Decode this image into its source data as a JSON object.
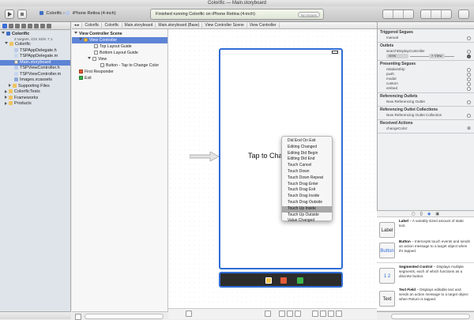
{
  "window": {
    "title_project": "Colorific",
    "title_file": "Main.storyboard"
  },
  "toolbar": {
    "scheme": "Colorific",
    "device": "iPhone Retina (4-inch)",
    "activity_text": "Finished running Colorific on iPhone Retina (4-inch)",
    "issues": "No Issues"
  },
  "navigator": {
    "items": [
      {
        "label": "Colorific",
        "sub": "2 targets, iOS SDK 7.1"
      },
      {
        "label": "Colorific"
      },
      {
        "label": "TSPAppDelegate.h"
      },
      {
        "label": "TSPAppDelegate.m"
      },
      {
        "label": "Main.storyboard"
      },
      {
        "label": "TSPViewController.h"
      },
      {
        "label": "TSPViewController.m"
      },
      {
        "label": "Images.xcassets"
      },
      {
        "label": "Supporting Files"
      },
      {
        "label": "ColorificTests"
      },
      {
        "label": "Frameworks"
      },
      {
        "label": "Products"
      }
    ]
  },
  "jumpbar": [
    "Colorific",
    "Colorific",
    "Main.storyboard",
    "Main.storyboard (Base)",
    "View Controller Scene",
    "View Controller"
  ],
  "outline": {
    "items": [
      "View Controller Scene",
      "View Controller",
      "Top Layout Guide",
      "Bottom Layout Guide",
      "View",
      "Button - Tap to Change Color",
      "First Responder",
      "Exit"
    ]
  },
  "canvas": {
    "button_label": "Tap to Change Color",
    "menu_items": [
      "Did End On Exit",
      "Editing Changed",
      "Editing Did Begin",
      "Editing Did End",
      "Touch Cancel",
      "Touch Down",
      "Touch Down Repeat",
      "Touch Drag Enter",
      "Touch Drag Exit",
      "Touch Drag Inside",
      "Touch Drag Outside",
      "Touch Up Inside",
      "Touch Up Outside",
      "Value Changed"
    ],
    "highlighted_index": 11
  },
  "inspector": {
    "triggered_segues": {
      "title": "Triggered Segues",
      "rows": [
        "manual"
      ]
    },
    "outlets": {
      "title": "Outlets",
      "rows": [
        "searchDisplayController"
      ],
      "view_row": "view",
      "view_target": "View"
    },
    "presenting_segues": {
      "title": "Presenting Segues",
      "rows": [
        "relationship",
        "push",
        "modal",
        "custom",
        "embed"
      ]
    },
    "referencing_outlets": {
      "title": "Referencing Outlets",
      "rows": [
        "New Referencing Outlet"
      ]
    },
    "referencing_collections": {
      "title": "Referencing Outlet Collections",
      "rows": [
        "New Referencing Outlet Collection"
      ]
    },
    "received_actions": {
      "title": "Received Actions",
      "rows": [
        "changeColor:"
      ]
    }
  },
  "library": {
    "tabs": [
      "{}"
    ],
    "items": [
      {
        "icon": "Label",
        "title": "Label",
        "desc": " – A variably sized amount of static text."
      },
      {
        "icon": "Button",
        "title": "Button",
        "desc": " – Intercepts touch events and sends an action message to a target object when it's tapped."
      },
      {
        "icon": "1 2",
        "title": "Segmented Control",
        "desc": " – Displays multiple segments, each of which functions as a discrete button."
      },
      {
        "icon": "Text",
        "title": "Text Field",
        "desc": " – Displays editable text and sends an action message to a target object when Return is tapped."
      }
    ]
  }
}
